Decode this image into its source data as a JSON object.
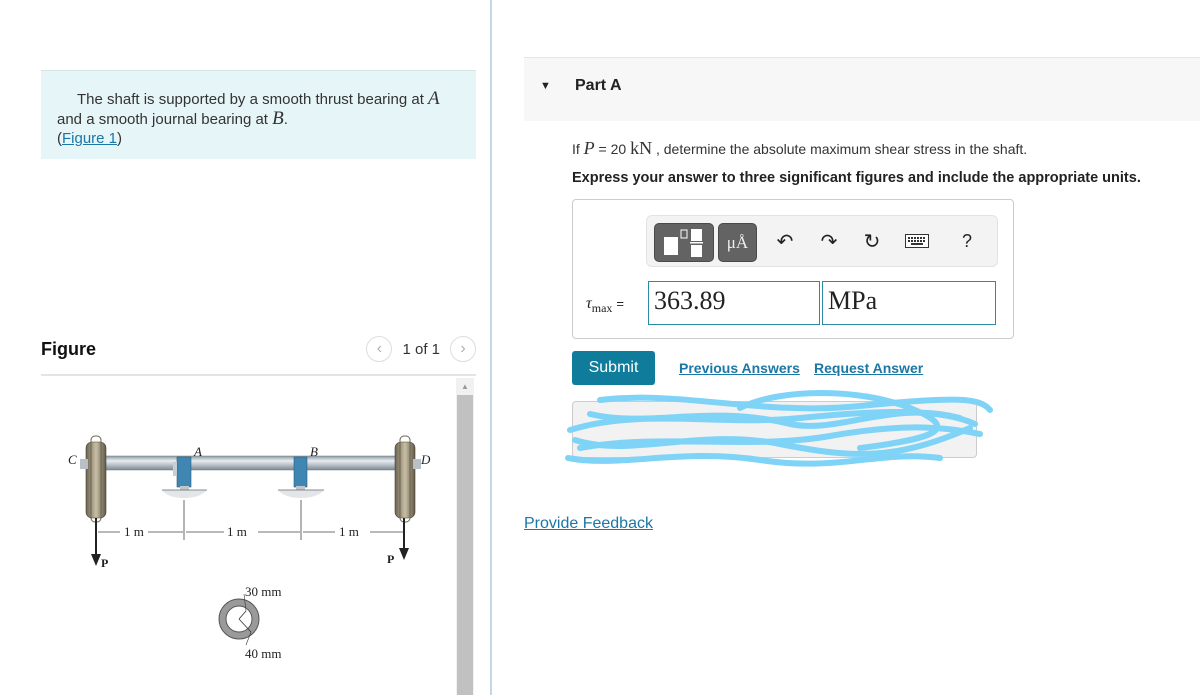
{
  "problem": {
    "intro_line1": "The shaft is supported by a smooth thrust bearing at ",
    "intro_var1": "A",
    "intro_line2": "and a smooth journal bearing at ",
    "intro_var2": "B",
    "intro_period": ".",
    "figure_link_open": "(",
    "figure_link": "Figure 1",
    "figure_link_close": ")"
  },
  "figure": {
    "title": "Figure",
    "pager": "1 of 1",
    "prev_icon": "chevron-left-icon",
    "next_icon": "chevron-right-icon",
    "labels": {
      "C": "C",
      "A": "A",
      "B": "B",
      "D": "D",
      "P_left": "P",
      "P_right": "P",
      "dim1": "1 m",
      "dim2": "1 m",
      "dim3": "1 m",
      "inner_radius": "30 mm",
      "outer_radius": "40 mm"
    }
  },
  "part": {
    "caret_icon": "caret-down-icon",
    "title": "Part A",
    "question_prefix": "If ",
    "question_var": "P",
    "question_eq": " = 20 ",
    "question_unit": "kN",
    "question_suffix": " , determine the absolute maximum shear stress in the shaft.",
    "instruction": "Express your answer to three significant figures and include the appropriate units."
  },
  "toolbar": {
    "templates_icon": "templates-icon",
    "units_label": "μÅ",
    "undo_icon": "undo-icon",
    "redo_icon": "redo-icon",
    "reset_icon": "reset-icon",
    "keyboard_icon": "keyboard-icon",
    "help_label": "?"
  },
  "answer": {
    "label_var": "τ",
    "label_sub": "max",
    "label_eq": "=",
    "value": "363.89",
    "unit": "MPa"
  },
  "actions": {
    "submit": "Submit",
    "previous_answers": "Previous Answers",
    "request_answer": "Request Answer",
    "provide_feedback": "Provide Feedback"
  }
}
